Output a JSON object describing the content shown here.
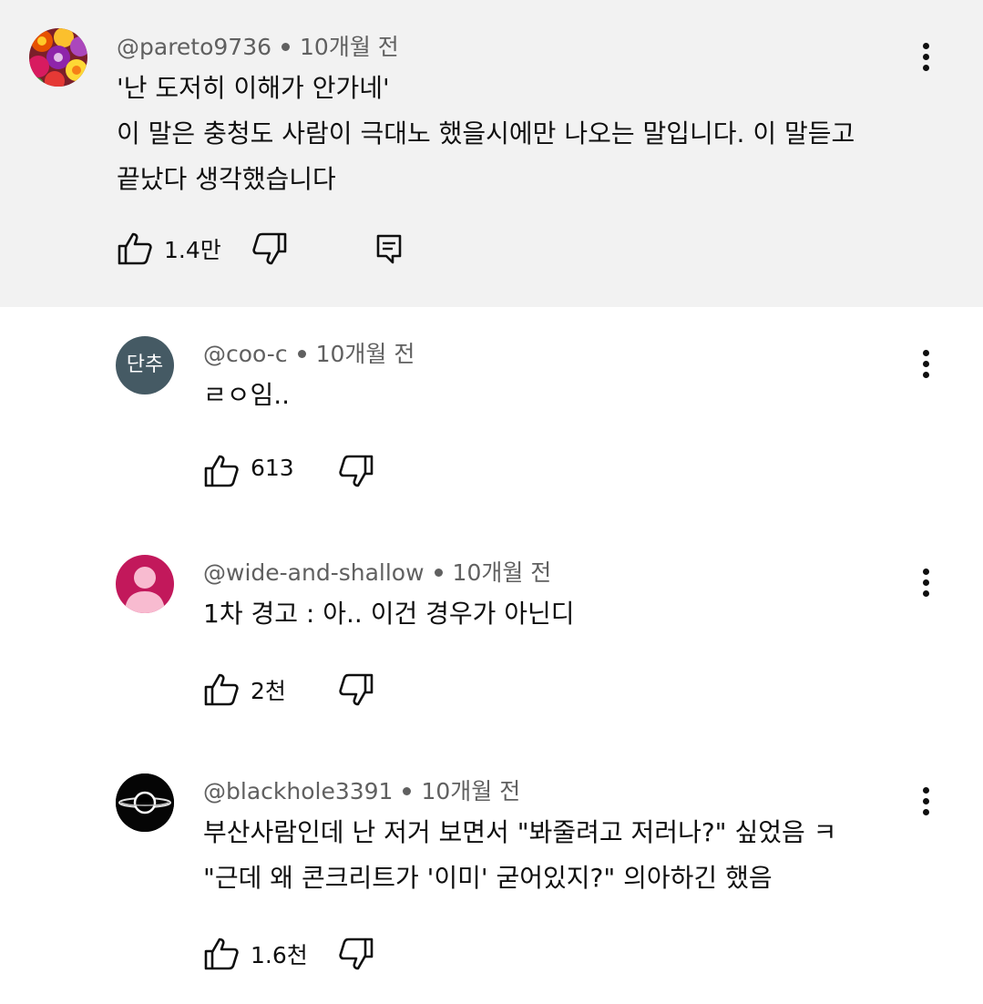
{
  "comments": [
    {
      "handle": "@pareto9736",
      "time": "10개월 전",
      "lines": [
        "'난 도저히 이해가 안가네'",
        "이 말은 충청도 사람이 극대노 했을시에만 나오는 말입니다. 이 말듣고",
        "끝났다 생각했습니다"
      ],
      "likes": "1.4만",
      "avatar": "flower-avatar"
    },
    {
      "handle": "@coo-c",
      "time": "10개월 전",
      "lines": [
        "ㄹㅇ임.."
      ],
      "likes": "613",
      "avatar_text": "단추",
      "avatar_color": "#455a64"
    },
    {
      "handle": "@wide-and-shallow",
      "time": "10개월 전",
      "lines": [
        "1차 경고 : 아.. 이건 경우가 아닌디"
      ],
      "likes": "2천",
      "avatar_color": "#c2185b"
    },
    {
      "handle": "@blackhole3391",
      "time": "10개월 전",
      "lines": [
        "부산사람인데 난 저거 보면서 \"봐줄려고 저러나?\" 싶었음 ㅋ",
        "\"근데 왜 콘크리트가 '이미' 굳어있지?\" 의아하긴 했음"
      ],
      "likes": "1.6천",
      "avatar": "blackhole-avatar"
    }
  ]
}
